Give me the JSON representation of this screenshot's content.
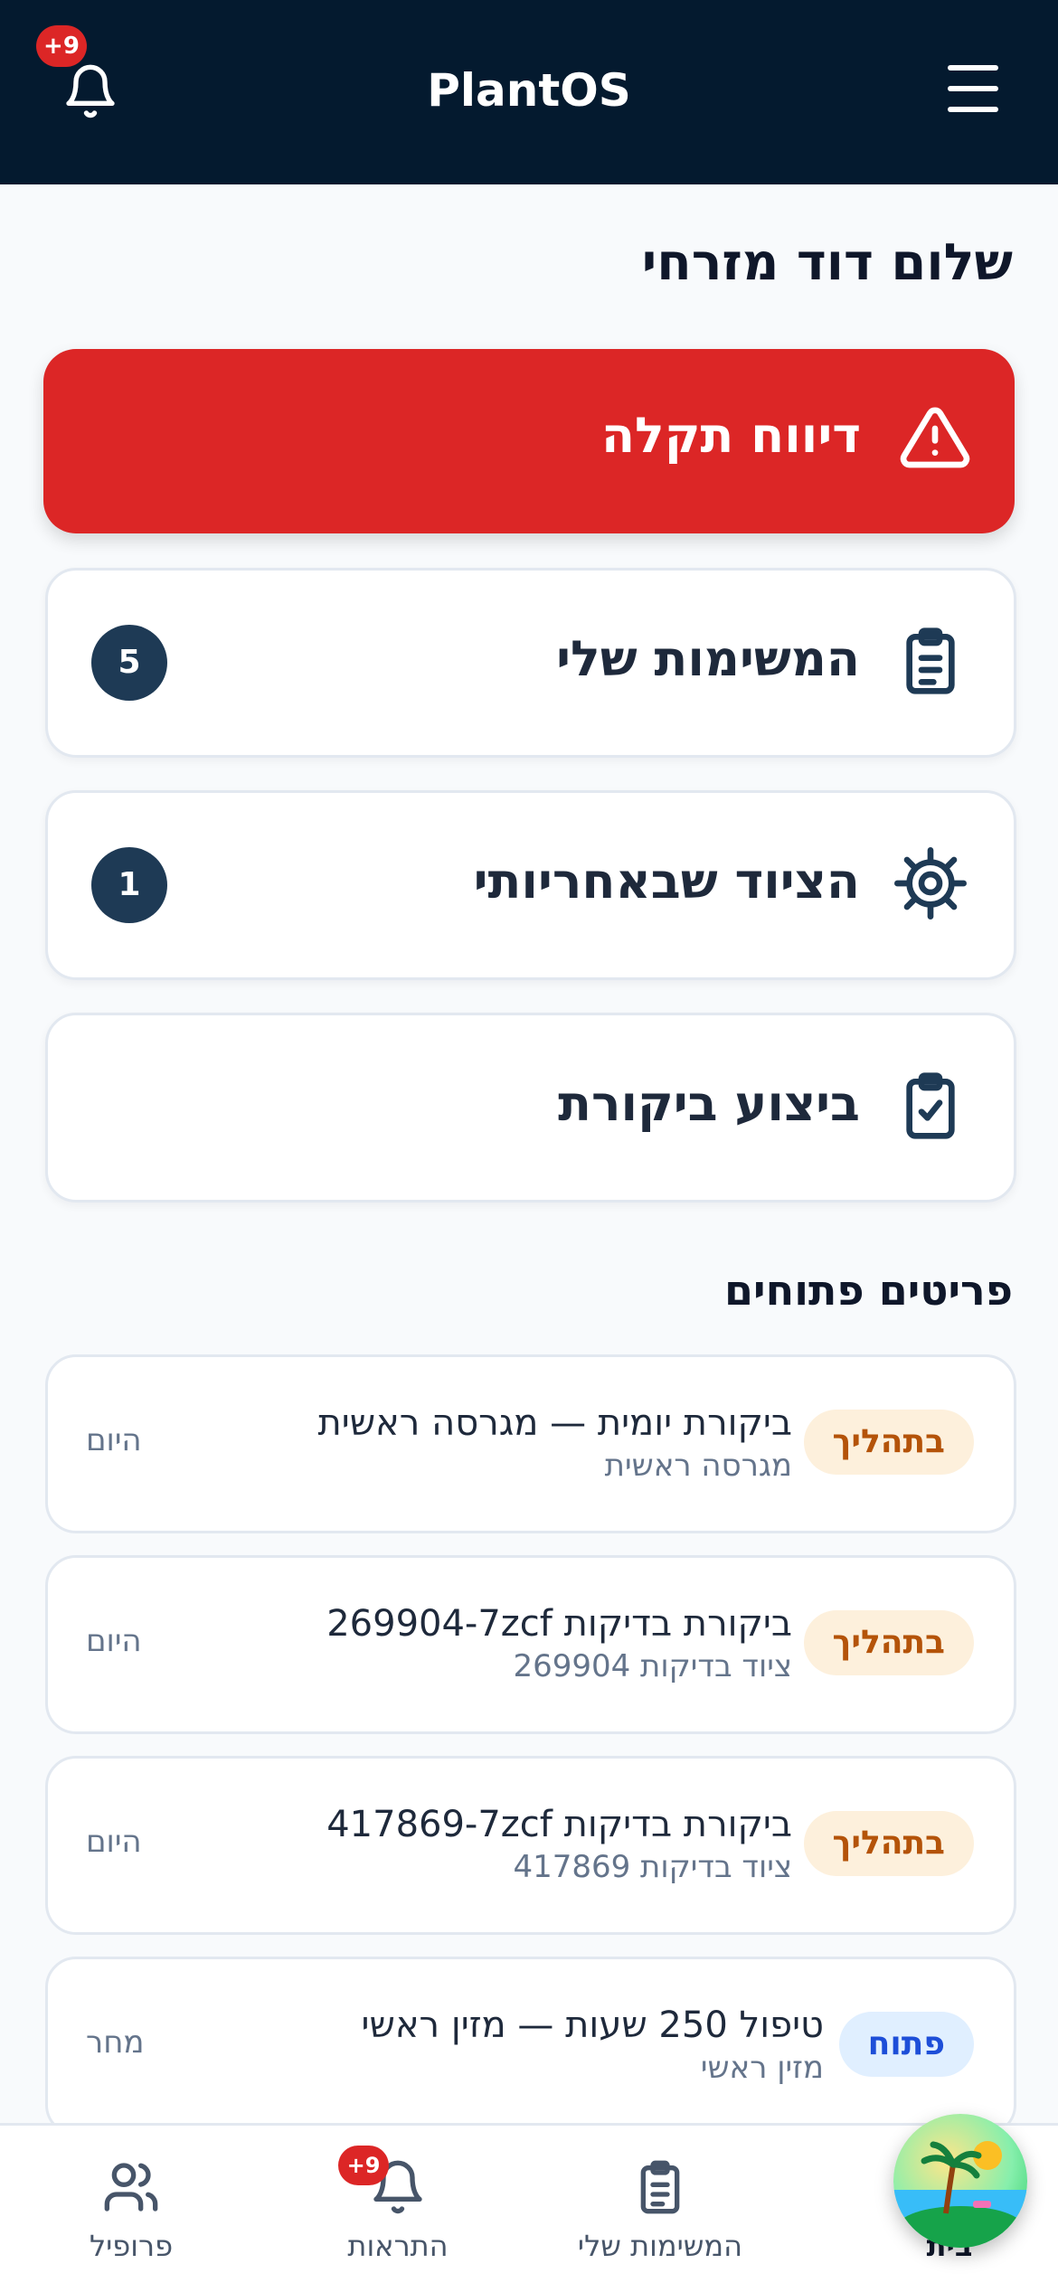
{
  "header": {
    "title": "PlantOS",
    "notification_badge": "+9"
  },
  "greeting": "שלום דוד מזרחי",
  "report_button": {
    "label": "דיווח תקלה"
  },
  "menu_cards": [
    {
      "label": "המשימות שלי",
      "icon": "clipboard-list-icon",
      "count": "5"
    },
    {
      "label": "הציוד שבאחריותי",
      "icon": "gear-icon",
      "count": "1"
    },
    {
      "label": "ביצוע ביקורת",
      "icon": "clipboard-check-icon"
    }
  ],
  "open_items": {
    "title": "פריטים פתוחים",
    "items": [
      {
        "title": "ביקורת יומית — מגרסה ראשית",
        "subtitle": "מגרסה ראשית",
        "status": "בתהליך",
        "when": "היום"
      },
      {
        "title": "ביקורת בדיקות 269904-7zcf",
        "subtitle": "ציוד בדיקות 269904",
        "status": "בתהליך",
        "when": "היום"
      },
      {
        "title": "ביקורת בדיקות 417869-7zcf",
        "subtitle": "ציוד בדיקות 417869",
        "status": "בתהליך",
        "when": "היום"
      },
      {
        "title": "טיפול 250 שעות — מזין ראשי",
        "subtitle": "מזין ראשי",
        "status": "פתוח",
        "when": "מחר"
      }
    ]
  },
  "bottom_nav": {
    "profile": "פרופיל",
    "alerts": "התראות",
    "alerts_badge": "+9",
    "tasks": "המשימות שלי",
    "home": "בית"
  },
  "colors": {
    "header_bg": "#041a2f",
    "report_bg": "#dc2626",
    "accent": "#1e3a55"
  }
}
